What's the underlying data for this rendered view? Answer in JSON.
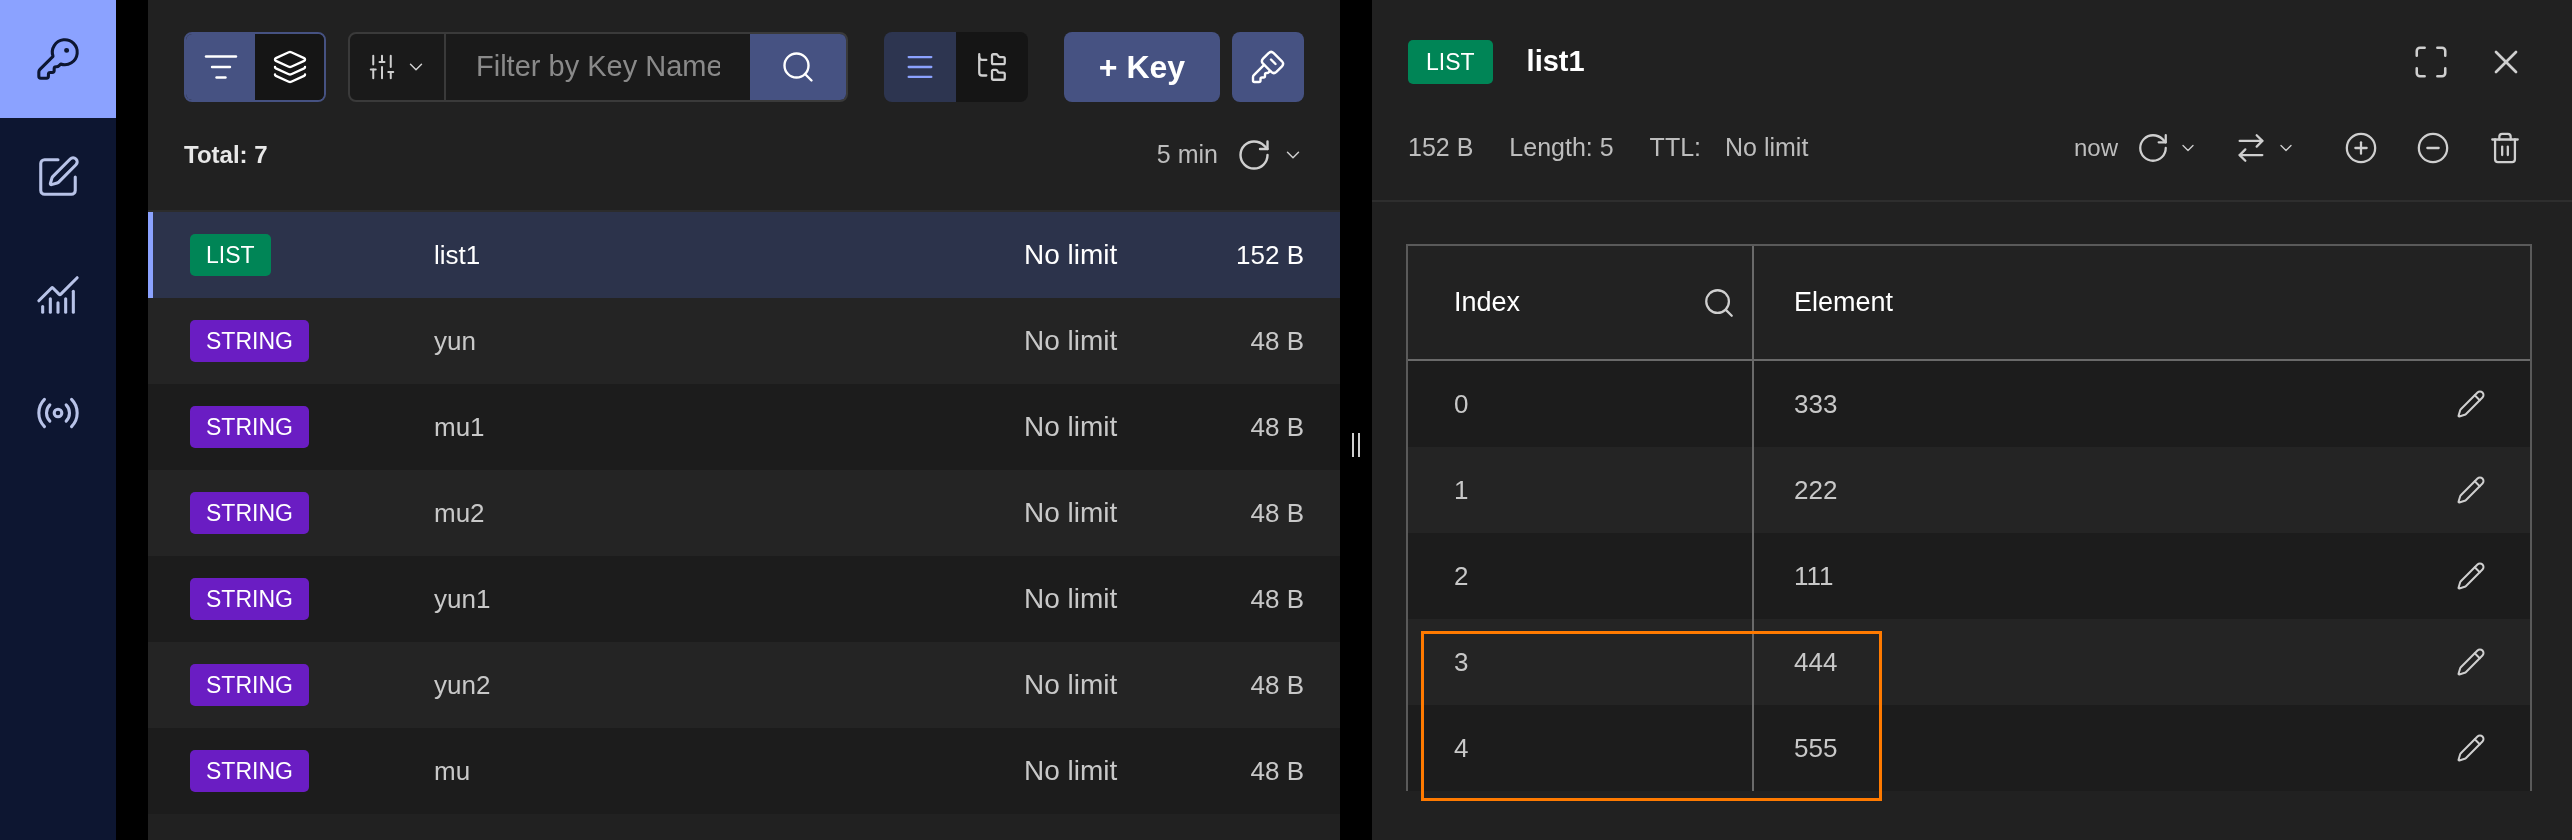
{
  "sidebar": {
    "items": [
      {
        "kind": "key",
        "selected": true
      },
      {
        "kind": "edit",
        "selected": false
      },
      {
        "kind": "chart",
        "selected": false
      },
      {
        "kind": "broadcast",
        "selected": false
      }
    ]
  },
  "toolbar": {
    "filter_modes": [
      {
        "kind": "filter",
        "selected": true
      },
      {
        "kind": "stack",
        "selected": false
      }
    ],
    "search": {
      "placeholder": "Filter by Key Name"
    },
    "view_modes": [
      {
        "kind": "list",
        "selected": true
      },
      {
        "kind": "tree",
        "selected": false
      }
    ],
    "add_key": "+ Key"
  },
  "summary": {
    "total": "Total: 7",
    "refresh_interval": "5 min"
  },
  "keys": [
    {
      "type": "LIST",
      "color": "#008556",
      "name": "list1",
      "ttl": "No limit",
      "size": "152 B",
      "selected": true
    },
    {
      "type": "STRING",
      "color": "#6a1dc3",
      "name": "yun",
      "ttl": "No limit",
      "size": "48 B",
      "selected": false
    },
    {
      "type": "STRING",
      "color": "#6a1dc3",
      "name": "mu1",
      "ttl": "No limit",
      "size": "48 B",
      "selected": false
    },
    {
      "type": "STRING",
      "color": "#6a1dc3",
      "name": "mu2",
      "ttl": "No limit",
      "size": "48 B",
      "selected": false
    },
    {
      "type": "STRING",
      "color": "#6a1dc3",
      "name": "yun1",
      "ttl": "No limit",
      "size": "48 B",
      "selected": false
    },
    {
      "type": "STRING",
      "color": "#6a1dc3",
      "name": "yun2",
      "ttl": "No limit",
      "size": "48 B",
      "selected": false
    },
    {
      "type": "STRING",
      "color": "#6a1dc3",
      "name": "mu",
      "ttl": "No limit",
      "size": "48 B",
      "selected": false
    }
  ],
  "detail": {
    "type": "LIST",
    "color": "#008556",
    "name": "list1",
    "size": "152 B",
    "length": "Length: 5",
    "ttl_label": "TTL:",
    "ttl": "No limit",
    "refreshed": "now",
    "table": {
      "columns": [
        "Index",
        "Element"
      ],
      "rows": [
        {
          "index": "0",
          "element": "333",
          "highlighted": false
        },
        {
          "index": "1",
          "element": "222",
          "highlighted": false
        },
        {
          "index": "2",
          "element": "111",
          "highlighted": false
        },
        {
          "index": "3",
          "element": "444",
          "highlighted": true
        },
        {
          "index": "4",
          "element": "555",
          "highlighted": true
        }
      ]
    }
  }
}
